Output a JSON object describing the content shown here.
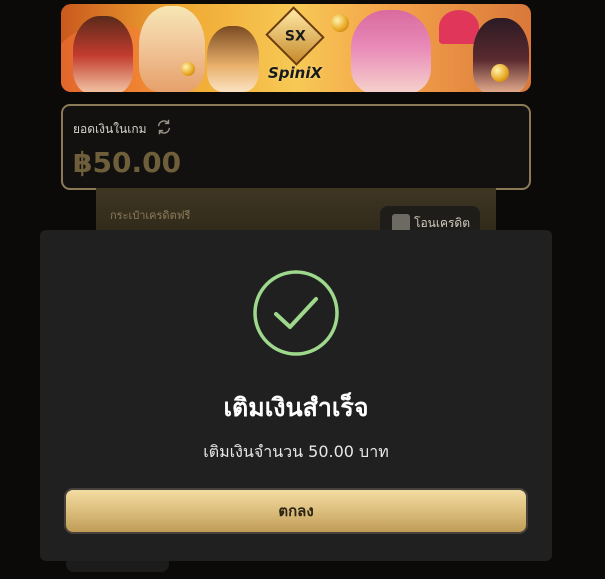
{
  "banner": {
    "logo_mark": "SX",
    "logo_text": "SpiniX"
  },
  "balance": {
    "label": "ยอดเงินในเกม",
    "amount": "฿50.00",
    "refresh_icon": "refresh-icon"
  },
  "free_credit": {
    "label": "กระเป๋าเครดิตฟรี",
    "transfer_label": "โอนเครดิต",
    "transfer_icon": "transfer-icon"
  },
  "modal": {
    "icon": "check-circle-icon",
    "title": "เติมเงินสำเร็จ",
    "message": "เติมเงินจำนวน 50.00 บาท",
    "ok_label": "ตกลง"
  },
  "colors": {
    "accent": "#9ed88c",
    "gold": "#d9bb79",
    "modal_bg": "#202020"
  }
}
